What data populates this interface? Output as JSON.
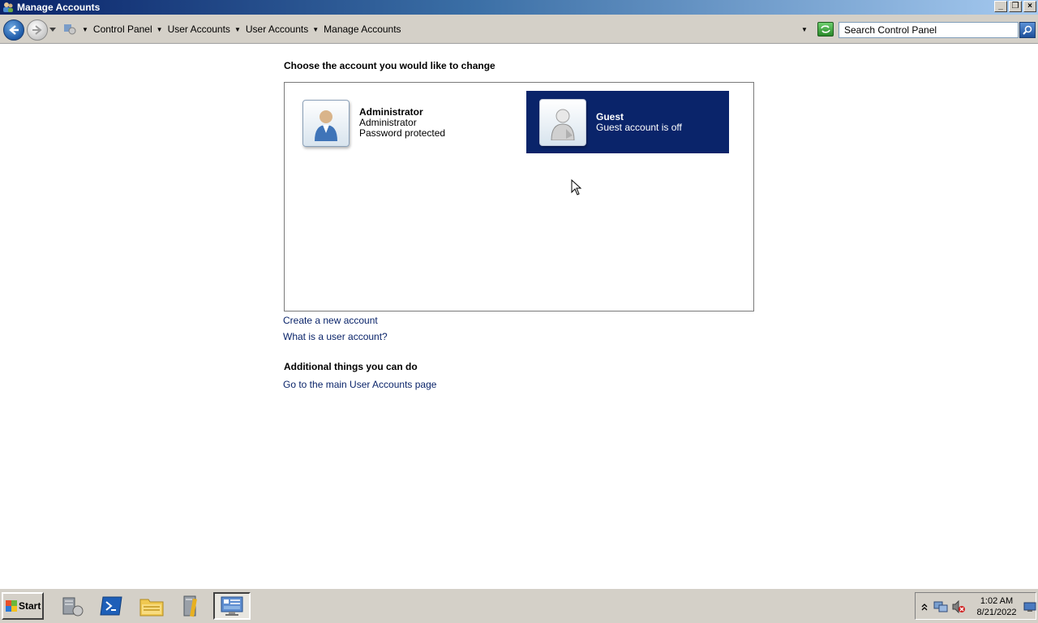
{
  "window": {
    "title": "Manage Accounts",
    "minimize": "_",
    "restore": "❐",
    "close": "×"
  },
  "address": {
    "breadcrumbs": [
      "Control Panel",
      "User Accounts",
      "User Accounts",
      "Manage Accounts"
    ],
    "search_placeholder": "Search Control Panel"
  },
  "main": {
    "choose_heading": "Choose the account you would like to change",
    "accounts": [
      {
        "name": "Administrator",
        "type": "Administrator",
        "status": "Password protected",
        "selected": false
      },
      {
        "name": "Guest",
        "status": "Guest account is off",
        "selected": true
      }
    ],
    "links": {
      "create": "Create a new account",
      "what_is": "What is a user account?"
    },
    "additional_heading": "Additional things you can do",
    "additional_links": [
      "Go to the main User Accounts page"
    ]
  },
  "taskbar": {
    "start_label": "Start",
    "apps": [
      "server-manager-icon",
      "powershell-icon",
      "explorer-icon",
      "admin-tools-icon",
      "control-panel-icon"
    ],
    "clock_time": "1:02 AM",
    "clock_date": "8/21/2022"
  },
  "colors": {
    "selection": "#0a246a",
    "link": "#0a246a",
    "title_gradient_start": "#0a246a"
  }
}
